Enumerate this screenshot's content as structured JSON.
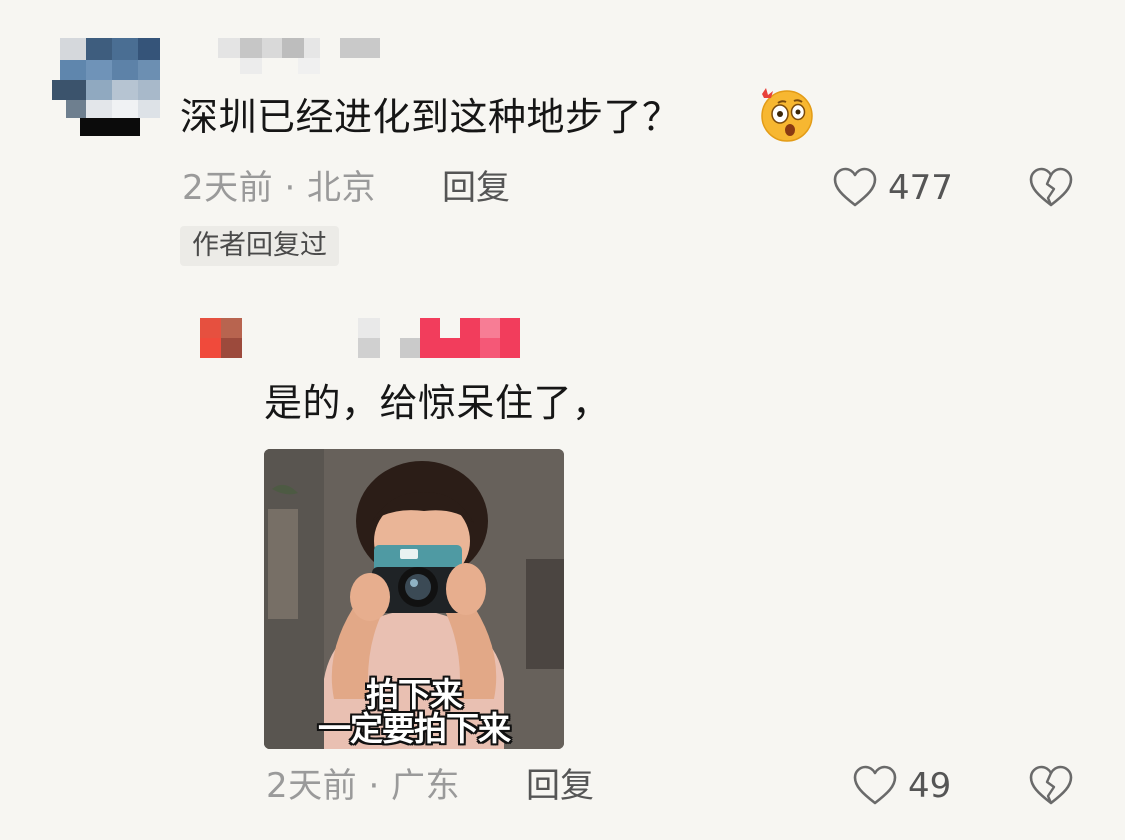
{
  "comments": [
    {
      "text": "深圳已经进化到这种地步了？",
      "meta": "2天前 · 北京",
      "reply_label": "回复",
      "likes": "477",
      "badge": "作者回复过",
      "emoji_icon": "surprised-face-emoji"
    },
    {
      "text": "是的，给惊呆住了，",
      "meta": "2天前 · 广东",
      "reply_label": "回复",
      "likes": "49",
      "sticker": {
        "caption_line1": "拍下来",
        "caption_line2": "一定要拍下来"
      }
    }
  ],
  "icons": {
    "like": "heart-outline-icon",
    "dislike": "broken-heart-icon"
  },
  "colors": {
    "background": "#f7f6f2",
    "meta_text": "#9a9a9a",
    "username_mosaic_accent": "#f23d5c",
    "emoji_yellow": "#f7b731"
  }
}
